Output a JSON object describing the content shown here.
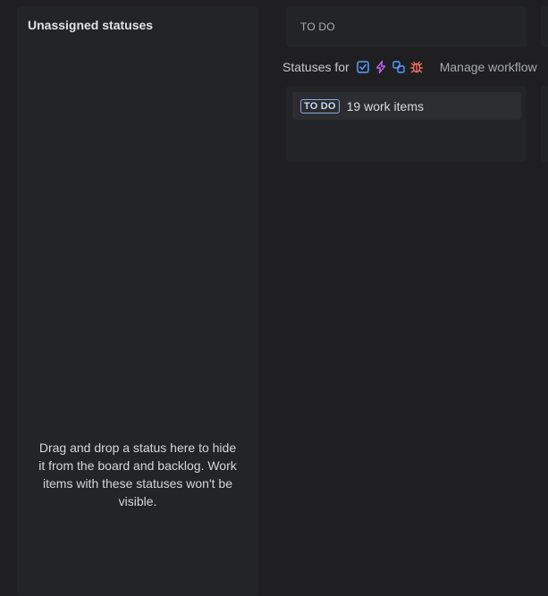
{
  "unassigned": {
    "title": "Unassigned statuses",
    "hint": "Drag and drop a status here to hide it from the board and backlog. Work items with these statuses won't be visible."
  },
  "column": {
    "title": "TO DO",
    "statuses_for_label": "Statuses for",
    "work_types": [
      {
        "icon": "task-checkbox-icon",
        "color": "#579dff"
      },
      {
        "icon": "epic-lightning-icon",
        "color": "#bf63f3"
      },
      {
        "icon": "subtask-icon",
        "color": "#579dff"
      },
      {
        "icon": "bug-icon",
        "color": "#f87462"
      }
    ],
    "manage_workflow_label": "Manage workflow",
    "status_card": {
      "lozenge": "TO DO",
      "count_text": "19 work items"
    }
  }
}
